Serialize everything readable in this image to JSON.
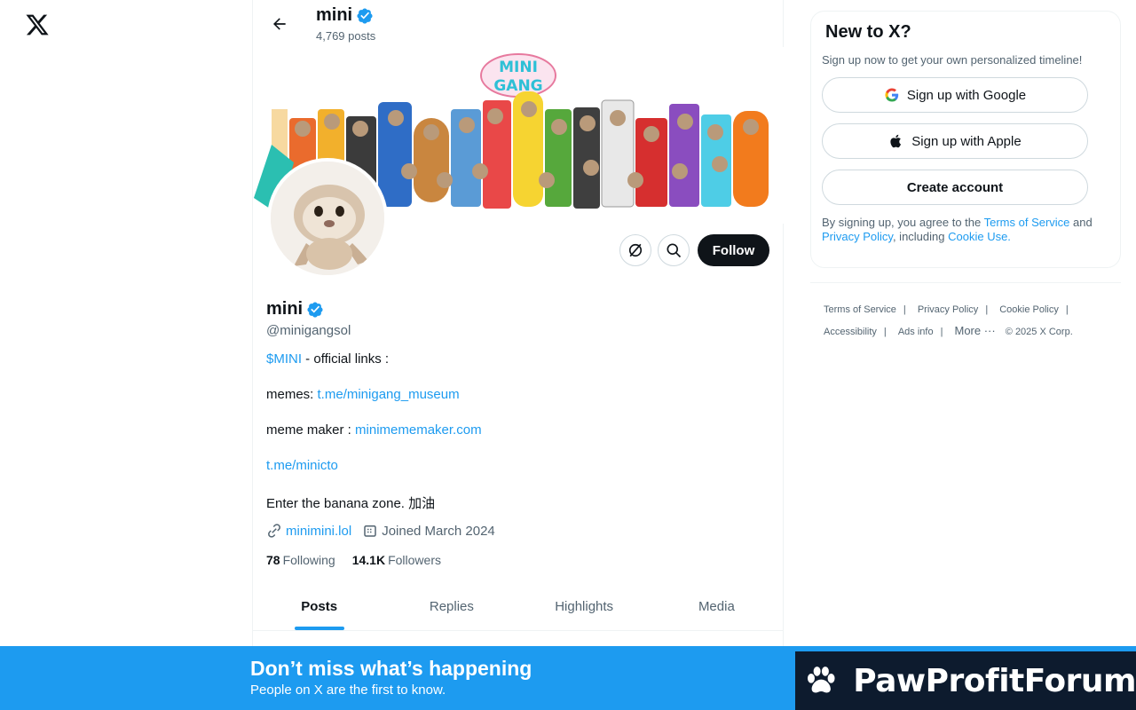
{
  "profile": {
    "name": "mini",
    "post_count": "4,769 posts",
    "handle": "@minigangsol",
    "follow_label": "Follow",
    "banner_text": "MINI GANG",
    "bio": {
      "l1_link": "$MINI",
      "l1_rest": " - official links :",
      "l2_prefix": "memes: ",
      "l2_link": "t.me/minigang_museum",
      "l3_prefix": "meme maker : ",
      "l3_link": "minimememaker.com",
      "l4_link": "t.me/minicto",
      "l5": "Enter the banana zone. 加油"
    },
    "website": "minimini.lol",
    "joined": "Joined March 2024",
    "following_count": "78",
    "following_label": "Following",
    "followers_count": "14.1K",
    "followers_label": "Followers"
  },
  "tabs": [
    {
      "label": "Posts"
    },
    {
      "label": "Replies"
    },
    {
      "label": "Highlights"
    },
    {
      "label": "Media"
    }
  ],
  "signup": {
    "title": "New to X?",
    "subtitle": "Sign up now to get your own personalized timeline!",
    "google": "Sign up with Google",
    "apple": "Sign up with Apple",
    "create": "Create account",
    "terms_pre": "By signing up, you agree to the ",
    "terms_link": "Terms of Service",
    "terms_and": " and ",
    "privacy_link": "Privacy Policy",
    "terms_mid": ", including ",
    "cookie_link": "Cookie Use."
  },
  "footer": {
    "links": [
      "Terms of Service",
      "Privacy Policy",
      "Cookie Policy",
      "Accessibility",
      "Ads info",
      "More ···"
    ],
    "copyright": "© 2025 X Corp."
  },
  "bottom_bar": {
    "title": "Don’t miss what’s happening",
    "subtitle": "People on X are the first to know."
  },
  "watermark": {
    "text": "PawProfitForum"
  },
  "colors": {
    "accent": "#1d9bf0",
    "verified": "#1d9bf0",
    "text": "#0f1419",
    "muted": "#536471"
  }
}
